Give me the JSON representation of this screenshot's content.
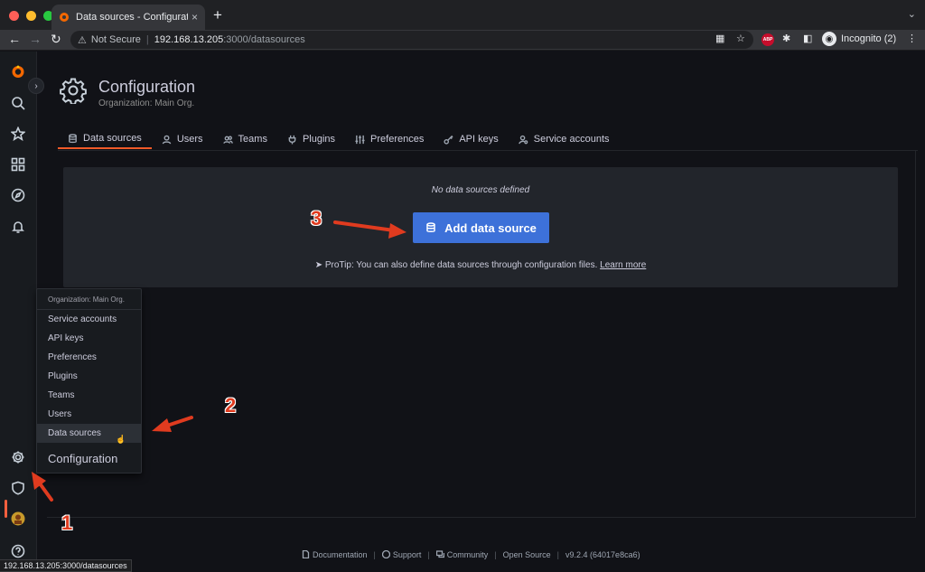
{
  "browser": {
    "tab_title": "Data sources - Configuration -",
    "tab_close": "×",
    "new_tab": "+",
    "security_label": "Not Secure",
    "url_host": "192.168.13.205",
    "url_path": ":3000/datasources",
    "extension_badge": "ABP",
    "profile_label": "Incognito (2)"
  },
  "page": {
    "title": "Configuration",
    "subtitle": "Organization: Main Org."
  },
  "tabs": [
    {
      "label": "Data sources",
      "icon": "database-icon",
      "active": true
    },
    {
      "label": "Users",
      "icon": "user-icon"
    },
    {
      "label": "Teams",
      "icon": "users-icon"
    },
    {
      "label": "Plugins",
      "icon": "plug-icon"
    },
    {
      "label": "Preferences",
      "icon": "sliders-icon"
    },
    {
      "label": "API keys",
      "icon": "key-icon"
    },
    {
      "label": "Service accounts",
      "icon": "user-cog-icon"
    }
  ],
  "empty_state": {
    "message": "No data sources defined",
    "button_label": "Add data source",
    "protip_text": "ProTip: You can also define data sources through configuration files.",
    "protip_link": "Learn more"
  },
  "popup_menu": {
    "header": "Organization: Main Org.",
    "items": [
      "Service accounts",
      "API keys",
      "Preferences",
      "Plugins",
      "Teams",
      "Users",
      "Data sources"
    ],
    "title": "Configuration"
  },
  "annotations": {
    "step1": "1",
    "step2": "2",
    "step3": "3",
    "color": "#e03b1f"
  },
  "footer": {
    "documentation": "Documentation",
    "support": "Support",
    "community": "Community",
    "open_source": "Open Source",
    "version": "v9.2.4 (64017e8ca6)",
    "separator": "|"
  },
  "status_url": "192.168.13.205:3000/datasources",
  "colors": {
    "accent": "#f05a28",
    "primary_button": "#3d71d9",
    "panel": "#22252b",
    "background": "#111217"
  }
}
